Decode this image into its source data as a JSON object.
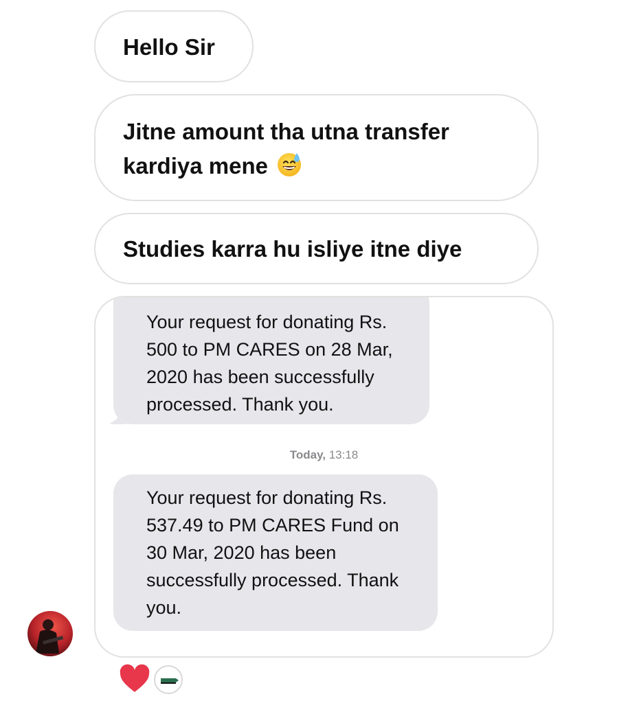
{
  "messages": [
    {
      "id": "hello",
      "text": "Hello Sir"
    },
    {
      "id": "transfer",
      "text": "Jitne amount tha utna transfer kardiya mene",
      "emoji": "grinning-face-with-sweat"
    },
    {
      "id": "studies",
      "text": "Studies karra hu isliye itne diye"
    }
  ],
  "shared_screenshot": {
    "sms": [
      {
        "text": "Your request for donating Rs. 500 to PM CARES on 28 Mar, 2020 has been successfully processed. Thank you."
      },
      {
        "text": "Your request for donating Rs. 537.49 to PM CARES Fund on 30 Mar, 2020 has been successfully processed. Thank you."
      }
    ],
    "timestamp": {
      "day": "Today,",
      "time": "13:18"
    }
  },
  "reactions": [
    {
      "type": "heart",
      "icon": "heart-icon",
      "color": "#e8364a"
    }
  ],
  "colors": {
    "bubble_border": "#e1e1e1",
    "sms_bubble": "#e6e6eb",
    "timestamp": "#8a8a8e",
    "heart": "#e8364a"
  }
}
